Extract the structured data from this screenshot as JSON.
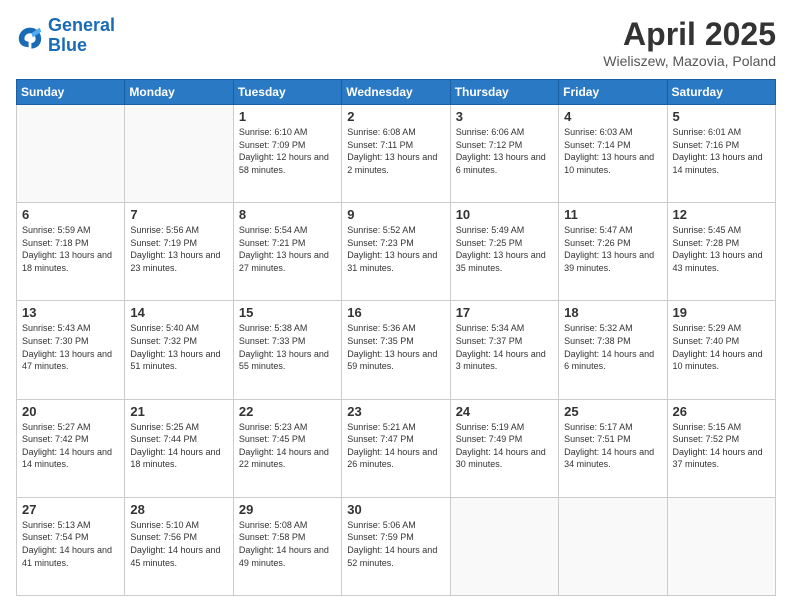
{
  "header": {
    "logo_line1": "General",
    "logo_line2": "Blue",
    "month": "April 2025",
    "location": "Wieliszew, Mazovia, Poland"
  },
  "weekdays": [
    "Sunday",
    "Monday",
    "Tuesday",
    "Wednesday",
    "Thursday",
    "Friday",
    "Saturday"
  ],
  "weeks": [
    [
      {
        "day": "",
        "info": ""
      },
      {
        "day": "",
        "info": ""
      },
      {
        "day": "1",
        "info": "Sunrise: 6:10 AM\nSunset: 7:09 PM\nDaylight: 12 hours\nand 58 minutes."
      },
      {
        "day": "2",
        "info": "Sunrise: 6:08 AM\nSunset: 7:11 PM\nDaylight: 13 hours\nand 2 minutes."
      },
      {
        "day": "3",
        "info": "Sunrise: 6:06 AM\nSunset: 7:12 PM\nDaylight: 13 hours\nand 6 minutes."
      },
      {
        "day": "4",
        "info": "Sunrise: 6:03 AM\nSunset: 7:14 PM\nDaylight: 13 hours\nand 10 minutes."
      },
      {
        "day": "5",
        "info": "Sunrise: 6:01 AM\nSunset: 7:16 PM\nDaylight: 13 hours\nand 14 minutes."
      }
    ],
    [
      {
        "day": "6",
        "info": "Sunrise: 5:59 AM\nSunset: 7:18 PM\nDaylight: 13 hours\nand 18 minutes."
      },
      {
        "day": "7",
        "info": "Sunrise: 5:56 AM\nSunset: 7:19 PM\nDaylight: 13 hours\nand 23 minutes."
      },
      {
        "day": "8",
        "info": "Sunrise: 5:54 AM\nSunset: 7:21 PM\nDaylight: 13 hours\nand 27 minutes."
      },
      {
        "day": "9",
        "info": "Sunrise: 5:52 AM\nSunset: 7:23 PM\nDaylight: 13 hours\nand 31 minutes."
      },
      {
        "day": "10",
        "info": "Sunrise: 5:49 AM\nSunset: 7:25 PM\nDaylight: 13 hours\nand 35 minutes."
      },
      {
        "day": "11",
        "info": "Sunrise: 5:47 AM\nSunset: 7:26 PM\nDaylight: 13 hours\nand 39 minutes."
      },
      {
        "day": "12",
        "info": "Sunrise: 5:45 AM\nSunset: 7:28 PM\nDaylight: 13 hours\nand 43 minutes."
      }
    ],
    [
      {
        "day": "13",
        "info": "Sunrise: 5:43 AM\nSunset: 7:30 PM\nDaylight: 13 hours\nand 47 minutes."
      },
      {
        "day": "14",
        "info": "Sunrise: 5:40 AM\nSunset: 7:32 PM\nDaylight: 13 hours\nand 51 minutes."
      },
      {
        "day": "15",
        "info": "Sunrise: 5:38 AM\nSunset: 7:33 PM\nDaylight: 13 hours\nand 55 minutes."
      },
      {
        "day": "16",
        "info": "Sunrise: 5:36 AM\nSunset: 7:35 PM\nDaylight: 13 hours\nand 59 minutes."
      },
      {
        "day": "17",
        "info": "Sunrise: 5:34 AM\nSunset: 7:37 PM\nDaylight: 14 hours\nand 3 minutes."
      },
      {
        "day": "18",
        "info": "Sunrise: 5:32 AM\nSunset: 7:38 PM\nDaylight: 14 hours\nand 6 minutes."
      },
      {
        "day": "19",
        "info": "Sunrise: 5:29 AM\nSunset: 7:40 PM\nDaylight: 14 hours\nand 10 minutes."
      }
    ],
    [
      {
        "day": "20",
        "info": "Sunrise: 5:27 AM\nSunset: 7:42 PM\nDaylight: 14 hours\nand 14 minutes."
      },
      {
        "day": "21",
        "info": "Sunrise: 5:25 AM\nSunset: 7:44 PM\nDaylight: 14 hours\nand 18 minutes."
      },
      {
        "day": "22",
        "info": "Sunrise: 5:23 AM\nSunset: 7:45 PM\nDaylight: 14 hours\nand 22 minutes."
      },
      {
        "day": "23",
        "info": "Sunrise: 5:21 AM\nSunset: 7:47 PM\nDaylight: 14 hours\nand 26 minutes."
      },
      {
        "day": "24",
        "info": "Sunrise: 5:19 AM\nSunset: 7:49 PM\nDaylight: 14 hours\nand 30 minutes."
      },
      {
        "day": "25",
        "info": "Sunrise: 5:17 AM\nSunset: 7:51 PM\nDaylight: 14 hours\nand 34 minutes."
      },
      {
        "day": "26",
        "info": "Sunrise: 5:15 AM\nSunset: 7:52 PM\nDaylight: 14 hours\nand 37 minutes."
      }
    ],
    [
      {
        "day": "27",
        "info": "Sunrise: 5:13 AM\nSunset: 7:54 PM\nDaylight: 14 hours\nand 41 minutes."
      },
      {
        "day": "28",
        "info": "Sunrise: 5:10 AM\nSunset: 7:56 PM\nDaylight: 14 hours\nand 45 minutes."
      },
      {
        "day": "29",
        "info": "Sunrise: 5:08 AM\nSunset: 7:58 PM\nDaylight: 14 hours\nand 49 minutes."
      },
      {
        "day": "30",
        "info": "Sunrise: 5:06 AM\nSunset: 7:59 PM\nDaylight: 14 hours\nand 52 minutes."
      },
      {
        "day": "",
        "info": ""
      },
      {
        "day": "",
        "info": ""
      },
      {
        "day": "",
        "info": ""
      }
    ]
  ]
}
